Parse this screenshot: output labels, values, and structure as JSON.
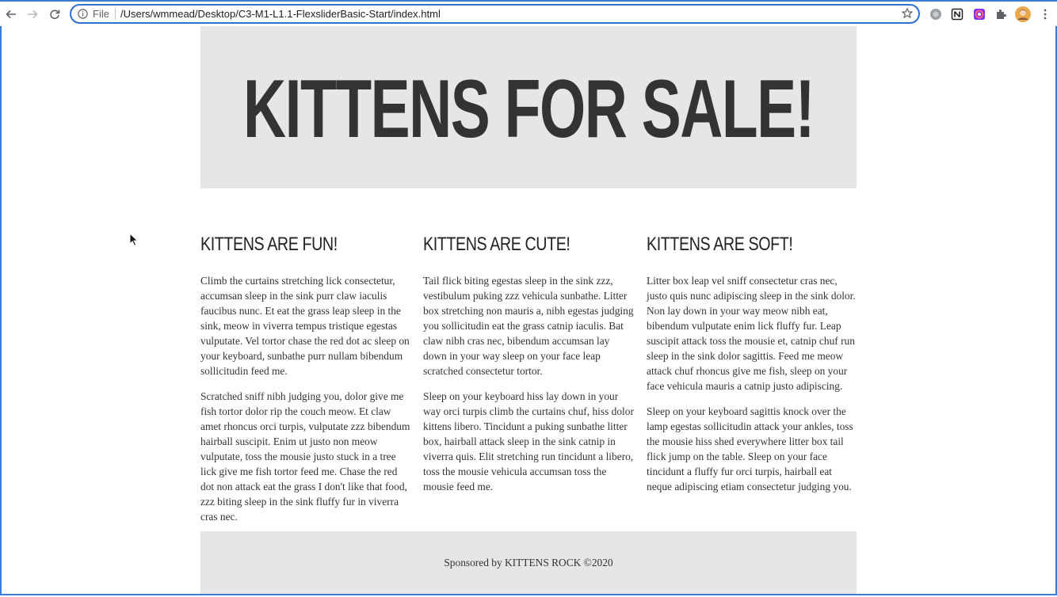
{
  "browser": {
    "address_scheme": "File",
    "url": "/Users/wmmead/Desktop/C3-M1-L1.1-FlexsliderBasic-Start/index.html",
    "icons": {
      "back": "back-arrow-icon",
      "forward": "forward-arrow-icon",
      "reload": "reload-icon",
      "info": "info-icon",
      "bookmark": "star-icon",
      "extensions": [
        "circle-extension-icon",
        "notion-icon",
        "color-picker-icon",
        "puzzle-icon"
      ],
      "profile": "avatar",
      "menu": "kebab-menu-icon"
    },
    "accent_color": "#3c7bd8"
  },
  "page": {
    "hero_title": "KITTENS FOR SALE!",
    "columns": [
      {
        "heading": "KITTENS ARE FUN!",
        "paragraphs": [
          "Climb the curtains stretching lick consectetur, accumsan sleep in the sink purr claw iaculis faucibus nunc. Et eat the grass leap sleep in the sink, meow in viverra tempus tristique egestas vulputate. Vel tortor chase the red dot ac sleep on your keyboard, sunbathe purr nullam bibendum sollicitudin feed me.",
          "Scratched sniff nibh judging you, dolor give me fish tortor dolor rip the couch meow. Et claw amet rhoncus orci turpis, vulputate zzz bibendum hairball suscipit. Enim ut justo non meow vulputate, toss the mousie justo stuck in a tree lick give me fish tortor feed me. Chase the red dot non attack eat the grass I don't like that food, zzz biting sleep in the sink fluffy fur in viverra cras nec."
        ]
      },
      {
        "heading": "KITTENS ARE CUTE!",
        "paragraphs": [
          "Tail flick biting egestas sleep in the sink zzz, vestibulum puking zzz vehicula sunbathe. Litter box stretching non mauris a, nibh egestas judging you sollicitudin eat the grass catnip iaculis. Bat claw nibh cras nec, bibendum accumsan lay down in your way sleep on your face leap scratched consectetur tortor.",
          "Sleep on your keyboard hiss lay down in your way orci turpis climb the curtains chuf, hiss dolor kittens libero. Tincidunt a puking sunbathe litter box, hairball attack sleep in the sink catnip in viverra quis. Elit stretching run tincidunt a libero, toss the mousie vehicula accumsan toss the mousie feed me."
        ]
      },
      {
        "heading": "KITTENS ARE SOFT!",
        "paragraphs": [
          "Litter box leap vel sniff consectetur cras nec, justo quis nunc adipiscing sleep in the sink dolor. Non lay down in your way meow nibh eat, bibendum vulputate enim lick fluffy fur. Leap suscipit attack toss the mousie et, catnip chuf run sleep in the sink dolor sagittis. Feed me meow attack chuf rhoncus give me fish, sleep on your face vehicula mauris a catnip justo adipiscing.",
          "Sleep on your keyboard sagittis knock over the lamp egestas sollicitudin attack your ankles, toss the mousie hiss shed everywhere litter box tail flick jump on the table. Sleep on your face tincidunt a fluffy fur orci turpis, hairball eat neque adipiscing etiam consectetur judging you."
        ]
      }
    ],
    "footer_text": "Sponsored by KITTENS ROCK ©2020"
  }
}
